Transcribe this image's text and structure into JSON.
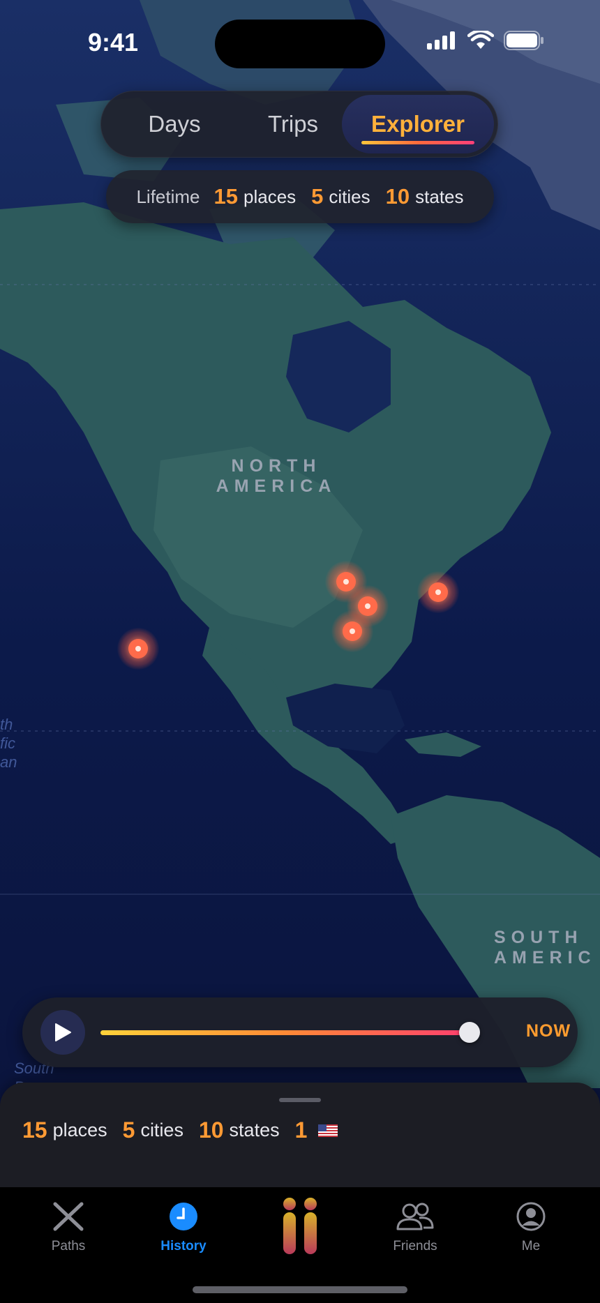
{
  "status_bar": {
    "time": "9:41"
  },
  "segmented": {
    "days": "Days",
    "trips": "Trips",
    "explorer": "Explorer",
    "selected": "Explorer"
  },
  "lifetime": {
    "label": "Lifetime",
    "places": "15",
    "places_unit": "places",
    "cities": "5",
    "cities_unit": "cities",
    "states": "10",
    "states_unit": "states"
  },
  "map": {
    "north_america_line1": "NORTH",
    "north_america_line2": "AMERICA",
    "south_america_line1": "SOUTH",
    "south_america_line2": "AMERIC",
    "pacific_ocean_fragment": [
      "th",
      "fic",
      "an"
    ],
    "south_pacific_fragment": [
      "South",
      "Pa"
    ],
    "pins": [
      "pin-west-coast",
      "pin-midwest-1",
      "pin-midwest-2",
      "pin-midwest-3",
      "pin-east-coast"
    ]
  },
  "timeline": {
    "now_label": "NOW",
    "progress": 0.98
  },
  "sheet": {
    "places": "15",
    "places_unit": "places",
    "cities": "5",
    "cities_unit": "cities",
    "states": "10",
    "states_unit": "states",
    "countries": "1",
    "country_flag": "US flag"
  },
  "tabbar": {
    "paths": "Paths",
    "history": "History",
    "friends": "Friends",
    "me": "Me",
    "active": "History"
  },
  "colors": {
    "accent_orange": "#ff9a34",
    "active_tab": "#1a8cff",
    "map_ocean": "#0b1440"
  }
}
